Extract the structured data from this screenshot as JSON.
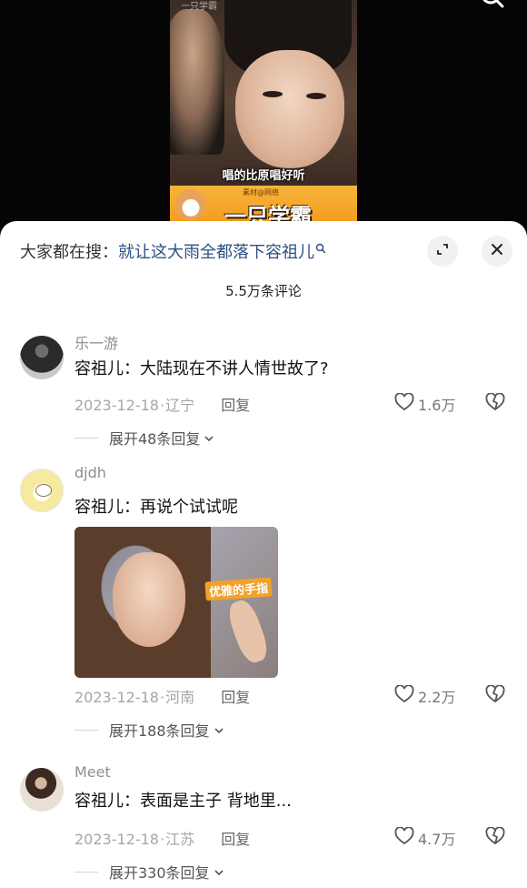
{
  "video": {
    "watermark": "一只学霸",
    "subtitle": "唱的比原唱好听",
    "banner_small": "素材@网络",
    "banner_big": "一只学霸",
    "top_icon": "search-icon"
  },
  "sheet": {
    "search_prefix": "大家都在搜：",
    "search_query": "就让这大雨全都落下容祖儿",
    "search_icon": "search-icon",
    "expand_icon": "expand-icon",
    "close_icon": "close-icon",
    "comment_count": "5.5万条评论"
  },
  "comments": [
    {
      "username": "乐一游",
      "text": "容祖儿：大陆现在不讲人情世故了?",
      "date": "2023-12-18",
      "location": "辽宁",
      "reply": "回复",
      "likes": "1.6万",
      "expand": "展开48条回复"
    },
    {
      "username": "djdh",
      "text": "容祖儿：再说个试试呢",
      "image_caption": "优雅的手指",
      "date": "2023-12-18",
      "location": "河南",
      "reply": "回复",
      "likes": "2.2万",
      "expand": "展开188条回复"
    },
    {
      "username": "Meet",
      "text": "容祖儿：表面是主子 背地里...",
      "date": "2023-12-18",
      "location": "江苏",
      "reply": "回复",
      "likes": "4.7万",
      "expand": "展开330条回复"
    }
  ],
  "colors": {
    "link": "#2a5180",
    "muted": "#a6a6ab",
    "sheet_bg": "#ffffff"
  }
}
